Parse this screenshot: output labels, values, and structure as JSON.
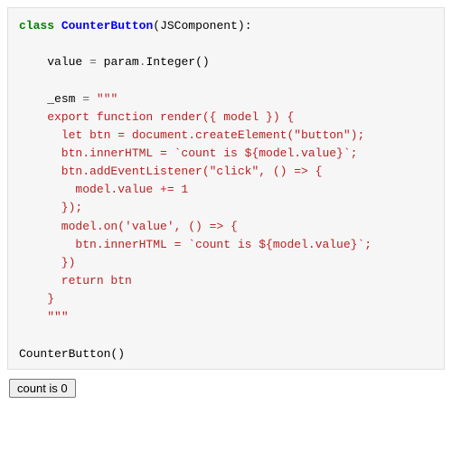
{
  "code": {
    "kw_class": "class",
    "class_name": "CounterButton",
    "base": "JSComponent",
    "attr_value": "value",
    "eq": "=",
    "param_call": "param",
    "integer_call": "Integer",
    "attr_esm": "_esm",
    "esm_open": "\"\"\"",
    "js_export": "export function",
    "render_name": "render",
    "render_args": "({ model }) {",
    "let_btn": "let btn = document.createElement(",
    "btn_arg": "\"button\"",
    "let_btn_end": ");",
    "inner1a": "btn.innerHTML = ",
    "inner1b": "`count is ${model.value}`",
    "inner1c": ";",
    "add_ev_a": "btn.addEventListener(",
    "add_ev_arg": "\"click\"",
    "add_ev_b": ", () => {",
    "inc": "model.value += 1",
    "close_arrow": "});",
    "model_on_a": "model.on(",
    "model_on_arg": "'value'",
    "model_on_b": ", () => {",
    "inner2a": "btn.innerHTML = ",
    "inner2b": "`count is ${model.value}`",
    "inner2c": ";",
    "close_on": "})",
    "return_kw": "return",
    "return_val": "btn",
    "close_fn": "}",
    "esm_close": "\"\"\"",
    "call": "CounterButton()"
  },
  "output": {
    "button_label": "count is 0"
  }
}
